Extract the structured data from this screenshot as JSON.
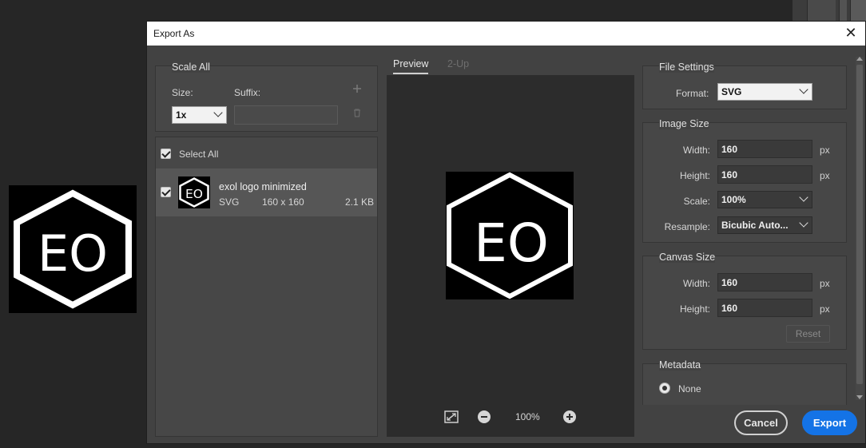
{
  "dialog": {
    "title": "Export As",
    "close_glyph": "✕"
  },
  "scale_all": {
    "title": "Scale All",
    "size_label": "Size:",
    "suffix_label": "Suffix:",
    "size_value": "1x",
    "suffix_value": "",
    "add_icon": "plus-icon",
    "delete_icon": "trash-icon"
  },
  "assets": {
    "select_all_label": "Select All",
    "items": [
      {
        "name": "exol logo minimized",
        "format": "SVG",
        "dimensions": "160 x 160",
        "size": "2.1 KB",
        "checked": true
      }
    ]
  },
  "tabs": [
    {
      "label": "Preview",
      "active": true
    },
    {
      "label": "2-Up",
      "active": false
    }
  ],
  "zoom": {
    "value": "100%",
    "fit_icon": "fit-view-icon",
    "zoom_out_icon": "zoom-out-icon",
    "zoom_in_icon": "zoom-in-icon"
  },
  "file_settings": {
    "title": "File Settings",
    "format_label": "Format:",
    "format_value": "SVG"
  },
  "image_size": {
    "title": "Image Size",
    "width_label": "Width:",
    "width_value": "160",
    "height_label": "Height:",
    "height_value": "160",
    "scale_label": "Scale:",
    "scale_value": "100%",
    "resample_label": "Resample:",
    "resample_value": "Bicubic Auto...",
    "unit": "px"
  },
  "canvas_size": {
    "title": "Canvas Size",
    "width_label": "Width:",
    "width_value": "160",
    "height_label": "Height:",
    "height_value": "160",
    "unit": "px",
    "reset_label": "Reset"
  },
  "metadata": {
    "title": "Metadata",
    "option_none": "None"
  },
  "buttons": {
    "cancel": "Cancel",
    "export": "Export"
  },
  "logo_text": "EO",
  "colors": {
    "accent": "#1473e6",
    "dialog_bg": "#424242",
    "preview_bg": "#2c2c2c"
  }
}
